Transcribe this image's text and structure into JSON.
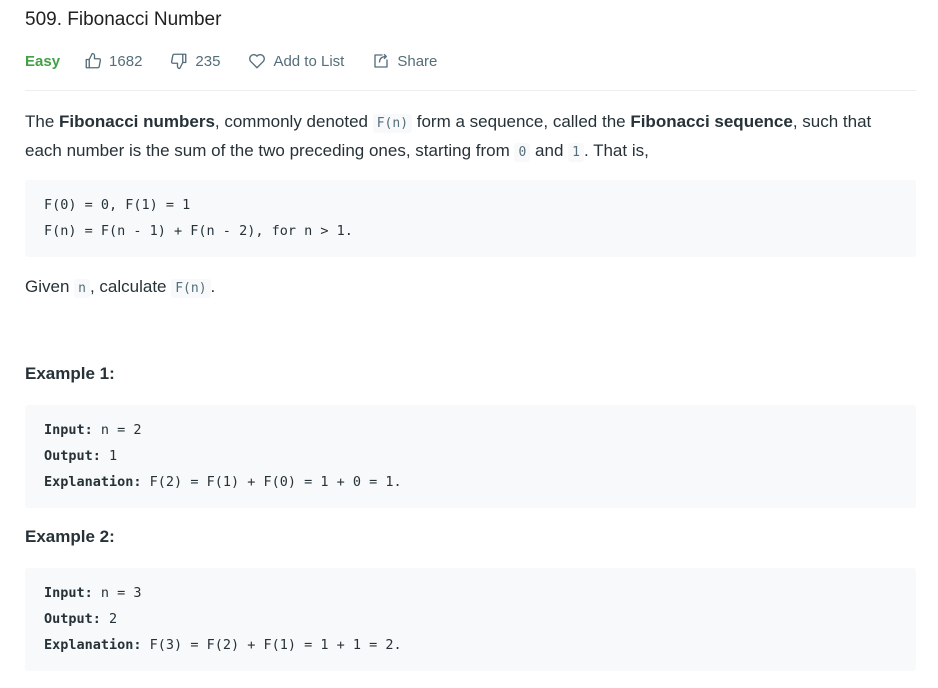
{
  "problem": {
    "title": "509. Fibonacci Number",
    "difficulty": "Easy",
    "likes": "1682",
    "dislikes": "235",
    "add_to_list": "Add to List",
    "share": "Share"
  },
  "description": {
    "p1_t1": "The ",
    "p1_b1": "Fibonacci numbers",
    "p1_t2": ", commonly denoted ",
    "p1_c1": "F(n)",
    "p1_t3": " form a sequence, called the ",
    "p1_b2": "Fibonacci sequence",
    "p1_t4": ", such that each number is the sum of the two preceding ones, starting from ",
    "p1_c2": "0",
    "p1_t5": " and ",
    "p1_c3": "1",
    "p1_t6": ". That is,",
    "formula_line1": "F(0) = 0, F(1) = 1",
    "formula_line2": "F(n) = F(n - 1) + F(n - 2), for n > 1.",
    "p2_t1": "Given ",
    "p2_c1": "n",
    "p2_t2": ", calculate ",
    "p2_c2": "F(n)",
    "p2_t3": "."
  },
  "examples": [
    {
      "heading": "Example 1:",
      "input_label": "Input:",
      "input_value": " n = 2",
      "output_label": "Output:",
      "output_value": " 1",
      "explanation_label": "Explanation:",
      "explanation_value": " F(2) = F(1) + F(0) = 1 + 0 = 1."
    },
    {
      "heading": "Example 2:",
      "input_label": "Input:",
      "input_value": " n = 3",
      "output_label": "Output:",
      "output_value": " 2",
      "explanation_label": "Explanation:",
      "explanation_value": " F(3) = F(2) + F(1) = 1 + 1 = 2."
    }
  ],
  "colors": {
    "easy": "#43a047",
    "meta_text": "#546e7a",
    "code_bg": "#f7f9fa"
  },
  "icons": {
    "like": "thumbs-up-icon",
    "dislike": "thumbs-down-icon",
    "add_to_list": "heart-icon",
    "share": "share-icon"
  }
}
